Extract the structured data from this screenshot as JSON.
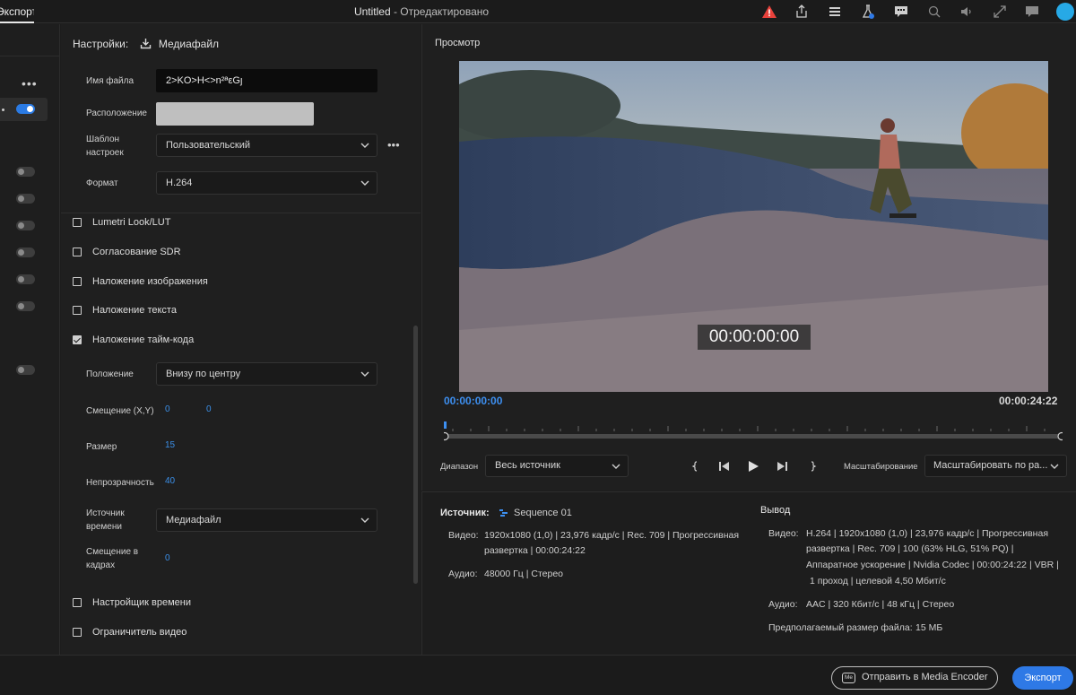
{
  "topbar": {
    "tab_export": "Экспорт",
    "title": "Untitled",
    "title_sub": " - Отредактировано"
  },
  "settings": {
    "header_label": "Настройки:",
    "header_target": "Медиафайл",
    "filename_label": "Имя файла",
    "filename_value": "2>KO>H<>n²ªεGȷ",
    "location_label": "Расположение",
    "preset_label_line1": "Шаблон",
    "preset_label_line2": "настроек",
    "preset_value": "Пользовательский",
    "format_label": "Формат",
    "format_value": "H.264",
    "sections": [
      {
        "label": "Lumetri Look/LUT",
        "checked": false
      },
      {
        "label": "Согласование SDR",
        "checked": false
      },
      {
        "label": "Наложение изображения",
        "checked": false
      },
      {
        "label": "Наложение текста",
        "checked": false
      },
      {
        "label": "Наложение тайм-кода",
        "checked": true
      }
    ],
    "timecode": {
      "position_label": "Положение",
      "position_value": "Внизу по центру",
      "offset_label": "Смещение (X,Y)",
      "offset_x": "0",
      "offset_y": "0",
      "size_label": "Размер",
      "size_value": "15",
      "opacity_label": "Непрозрачность",
      "opacity_value": "40",
      "source_label_line1": "Источник",
      "source_label_line2": "времени",
      "source_value": "Медиафайл",
      "frame_offset_label_line1": "Смещение в",
      "frame_offset_label_line2": "кадрах",
      "frame_offset_value": "0"
    },
    "sections_after": [
      {
        "label": "Настройщик времени",
        "checked": false
      },
      {
        "label": "Ограничитель видео",
        "checked": false
      }
    ]
  },
  "preview": {
    "title": "Просмотр",
    "overlay_timecode": "00:00:00:00",
    "timecode_current": "00:00:00:00",
    "timecode_duration": "00:00:24:22",
    "range_label": "Диапазон",
    "range_value": "Весь источник",
    "scale_label": "Масштабирование",
    "scale_value": "Масштабировать по ра..."
  },
  "info": {
    "source_label": "Источник:",
    "source_value": "Sequence 01",
    "source_video_label": "Видео:",
    "source_video_line1": "1920x1080 (1,0) | 23,976 кадр/с | Rec. 709 | Прогрессивная",
    "source_video_line2": "развертка | 00:00:24:22",
    "source_audio_label": "Аудио:",
    "source_audio_value": "48000 Гц | Стерео",
    "output_label": "Вывод",
    "output_video_label": "Видео:",
    "output_video_line1": "H.264 | 1920x1080 (1,0) | 23,976 кадр/с | Прогрессивная",
    "output_video_line2": "развертка | Rec. 709 | 100 (63% HLG, 51% PQ) |",
    "output_video_line3": "Аппаратное ускорение | Nvidia Codec | 00:00:24:22 | VBR |",
    "output_video_line4": "1 проход | целевой 4,50 Мбит/с",
    "output_audio_label": "Аудио:",
    "output_audio_value": "AAC | 320 Кбит/с | 48 кГц | Стерео",
    "filesize_label": "Предполагаемый размер файла:",
    "filesize_value": "15 МБ"
  },
  "bottom": {
    "media_encoder_icon": "Me",
    "media_encoder_label": "Отправить в Media Encoder",
    "export_label": "Экспорт"
  },
  "colors": {
    "accent": "#2e79e6",
    "timecode_blue": "#3d8ff0",
    "warning_red": "#e8413b",
    "toggle_on": "#2b7be4"
  }
}
